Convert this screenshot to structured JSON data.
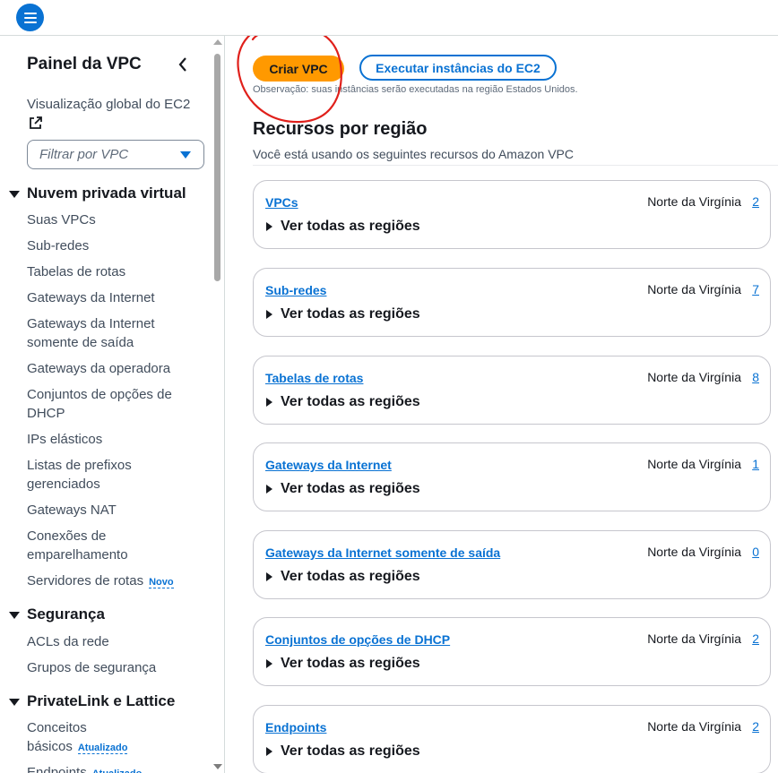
{
  "sidebar": {
    "title": "Painel da VPC",
    "ec2_link": "Visualização global do EC2",
    "filter_placeholder": "Filtrar por VPC",
    "sections": {
      "vpc": "Nuvem privada virtual",
      "security": "Segurança",
      "privatelink": "PrivateLink e Lattice"
    },
    "items": {
      "suas_vpcs": "Suas VPCs",
      "subredes": "Sub-redes",
      "tabelas_rotas": "Tabelas de rotas",
      "gateways_internet": "Gateways da Internet",
      "gateways_saida": "Gateways da Internet somente de saída",
      "gateways_operadora": "Gateways da operadora",
      "conjuntos_dhcp": "Conjuntos de opções de DHCP",
      "ips_elasticos": "IPs elásticos",
      "listas_prefixos": "Listas de prefixos gerenciados",
      "gateways_nat": "Gateways NAT",
      "conexoes": "Conexões de emparelhamento",
      "servidores_rotas": "Servidores de rotas",
      "acls": "ACLs da rede",
      "grupos_seguranca": "Grupos de segurança",
      "conceitos": "Conceitos básicos",
      "endpoints": "Endpoints"
    },
    "badges": {
      "novo": "Novo",
      "atualizado": "Atualizado"
    }
  },
  "main": {
    "create_vpc": "Criar VPC",
    "launch_ec2": "Executar instâncias do EC2",
    "note": "Observação: suas instâncias serão executadas na região Estados Unidos.",
    "resources_title": "Recursos por região",
    "resources_desc": "Você está usando os seguintes recursos do Amazon VPC",
    "expand_label": "Ver todas as regiões",
    "cards": [
      {
        "name": "VPCs",
        "region": "Norte da Virgínia",
        "count": "2"
      },
      {
        "name": "Sub-redes",
        "region": "Norte da Virgínia",
        "count": "7"
      },
      {
        "name": "Tabelas de rotas",
        "region": "Norte da Virgínia",
        "count": "8"
      },
      {
        "name": "Gateways da Internet",
        "region": "Norte da Virgínia",
        "count": "1"
      },
      {
        "name": "Gateways da Internet somente de saída",
        "region": "Norte da Virgínia",
        "count": "0"
      },
      {
        "name": "Conjuntos de opções de DHCP",
        "region": "Norte da Virgínia",
        "count": "2"
      },
      {
        "name": "Endpoints",
        "region": "Norte da Virgínia",
        "count": "2"
      }
    ]
  },
  "colors": {
    "primary_button": "#ff9900",
    "link": "#0972d3",
    "annotation": "#e0201b"
  },
  "icons": [
    "menu-icon",
    "chevron-left-icon",
    "external-link-icon",
    "caret-down-icon",
    "expand-triangle-icon"
  ]
}
